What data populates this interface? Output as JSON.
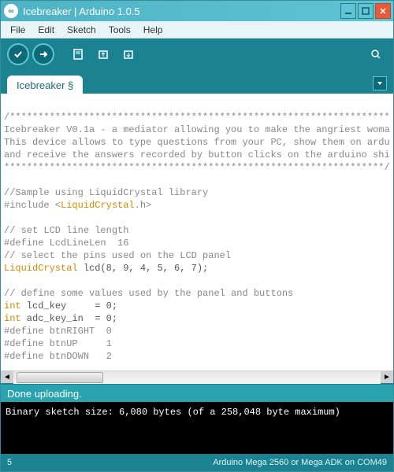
{
  "title": "Icebreaker | Arduino 1.0.5",
  "logo_text": "∞",
  "menu": {
    "file": "File",
    "edit": "Edit",
    "sketch": "Sketch",
    "tools": "Tools",
    "help": "Help"
  },
  "tab": {
    "name": "Icebreaker §"
  },
  "code": {
    "l1": "/*******************************************************************",
    "l2": "Icebreaker V0.1a - a mediator allowing you to make the angriest woma",
    "l3": "This device allows to type questions from your PC, show them on ardu",
    "l4": "and receive the answers recorded by button clicks on the arduino shi",
    "l5": "*******************************************************************/",
    "l6": "",
    "l7": "//Sample using LiquidCrystal library",
    "l8a": "#include <",
    "l8b": "LiquidCrystal",
    "l8c": ".h>",
    "l9": "",
    "l10": "// set LCD line length",
    "l11a": "#define LcdLineLen  16",
    "l12": "// select the pins used on the LCD panel",
    "l13a": "LiquidCrystal",
    "l13b": " lcd(8, 9, 4, 5, 6, 7);",
    "l14": "",
    "l15": "// define some values used by the panel and buttons",
    "l16a": "int",
    "l16b": " lcd_key     = 0;",
    "l17a": "int",
    "l17b": " adc_key_in  = 0;",
    "l18": "#define btnRIGHT  0",
    "l19": "#define btnUP     1",
    "l20": "#define btnDOWN   2"
  },
  "status": "Done uploading.",
  "console": "Binary sketch size: 6,080 bytes (of a 258,048 byte maximum)",
  "footer": {
    "line": "5",
    "board": "Arduino Mega 2560 or Mega ADK on COM49"
  }
}
